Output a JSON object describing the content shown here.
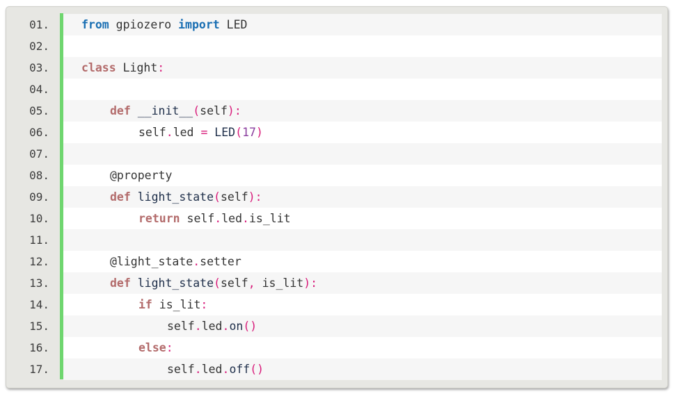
{
  "colors": {
    "gutter_accent": "#6fd66f",
    "keyword_blue": "#1a6fb3",
    "keyword_rose": "#b36b6b",
    "punctuation": "#d81b7a",
    "number": "#8a3d9e"
  },
  "code": {
    "lines": [
      {
        "num": "01.",
        "indent": 0,
        "tokens": [
          {
            "t": "from",
            "s": "kw1"
          },
          {
            "t": " gpiozero ",
            "s": "text"
          },
          {
            "t": "import",
            "s": "kw1"
          },
          {
            "t": " LED",
            "s": "text"
          }
        ]
      },
      {
        "num": "02.",
        "indent": 0,
        "tokens": []
      },
      {
        "num": "03.",
        "indent": 0,
        "tokens": [
          {
            "t": "class",
            "s": "kw2"
          },
          {
            "t": " Light",
            "s": "text"
          },
          {
            "t": ":",
            "s": "punc"
          }
        ]
      },
      {
        "num": "04.",
        "indent": 0,
        "tokens": []
      },
      {
        "num": "05.",
        "indent": 1,
        "tokens": [
          {
            "t": "def",
            "s": "kw2"
          },
          {
            "t": " __init__",
            "s": "name"
          },
          {
            "t": "(",
            "s": "punc"
          },
          {
            "t": "self",
            "s": "text"
          },
          {
            "t": "):",
            "s": "punc"
          }
        ]
      },
      {
        "num": "06.",
        "indent": 2,
        "tokens": [
          {
            "t": "self",
            "s": "text"
          },
          {
            "t": ".",
            "s": "punc"
          },
          {
            "t": "led ",
            "s": "text"
          },
          {
            "t": "=",
            "s": "punc"
          },
          {
            "t": " LED",
            "s": "name"
          },
          {
            "t": "(",
            "s": "punc"
          },
          {
            "t": "17",
            "s": "num"
          },
          {
            "t": ")",
            "s": "punc"
          }
        ]
      },
      {
        "num": "07.",
        "indent": 0,
        "tokens": []
      },
      {
        "num": "08.",
        "indent": 1,
        "tokens": [
          {
            "t": "@property",
            "s": "text"
          }
        ]
      },
      {
        "num": "09.",
        "indent": 1,
        "tokens": [
          {
            "t": "def",
            "s": "kw2"
          },
          {
            "t": " light_state",
            "s": "name"
          },
          {
            "t": "(",
            "s": "punc"
          },
          {
            "t": "self",
            "s": "text"
          },
          {
            "t": "):",
            "s": "punc"
          }
        ]
      },
      {
        "num": "10.",
        "indent": 2,
        "tokens": [
          {
            "t": "return",
            "s": "kw2"
          },
          {
            "t": " self",
            "s": "text"
          },
          {
            "t": ".",
            "s": "punc"
          },
          {
            "t": "led",
            "s": "text"
          },
          {
            "t": ".",
            "s": "punc"
          },
          {
            "t": "is_lit",
            "s": "text"
          }
        ]
      },
      {
        "num": "11.",
        "indent": 0,
        "tokens": []
      },
      {
        "num": "12.",
        "indent": 1,
        "tokens": [
          {
            "t": "@light_state",
            "s": "text"
          },
          {
            "t": ".",
            "s": "punc"
          },
          {
            "t": "setter",
            "s": "text"
          }
        ]
      },
      {
        "num": "13.",
        "indent": 1,
        "tokens": [
          {
            "t": "def",
            "s": "kw2"
          },
          {
            "t": " light_state",
            "s": "name"
          },
          {
            "t": "(",
            "s": "punc"
          },
          {
            "t": "self",
            "s": "text"
          },
          {
            "t": ",",
            "s": "punc"
          },
          {
            "t": " is_lit",
            "s": "text"
          },
          {
            "t": "):",
            "s": "punc"
          }
        ]
      },
      {
        "num": "14.",
        "indent": 2,
        "tokens": [
          {
            "t": "if",
            "s": "kw2"
          },
          {
            "t": " is_lit",
            "s": "text"
          },
          {
            "t": ":",
            "s": "punc"
          }
        ]
      },
      {
        "num": "15.",
        "indent": 3,
        "tokens": [
          {
            "t": "self",
            "s": "text"
          },
          {
            "t": ".",
            "s": "punc"
          },
          {
            "t": "led",
            "s": "text"
          },
          {
            "t": ".",
            "s": "punc"
          },
          {
            "t": "on",
            "s": "name"
          },
          {
            "t": "()",
            "s": "punc"
          }
        ]
      },
      {
        "num": "16.",
        "indent": 2,
        "tokens": [
          {
            "t": "else",
            "s": "kw2"
          },
          {
            "t": ":",
            "s": "punc"
          }
        ]
      },
      {
        "num": "17.",
        "indent": 3,
        "tokens": [
          {
            "t": "self",
            "s": "text"
          },
          {
            "t": ".",
            "s": "punc"
          },
          {
            "t": "led",
            "s": "text"
          },
          {
            "t": ".",
            "s": "punc"
          },
          {
            "t": "off",
            "s": "name"
          },
          {
            "t": "()",
            "s": "punc"
          }
        ]
      }
    ]
  }
}
